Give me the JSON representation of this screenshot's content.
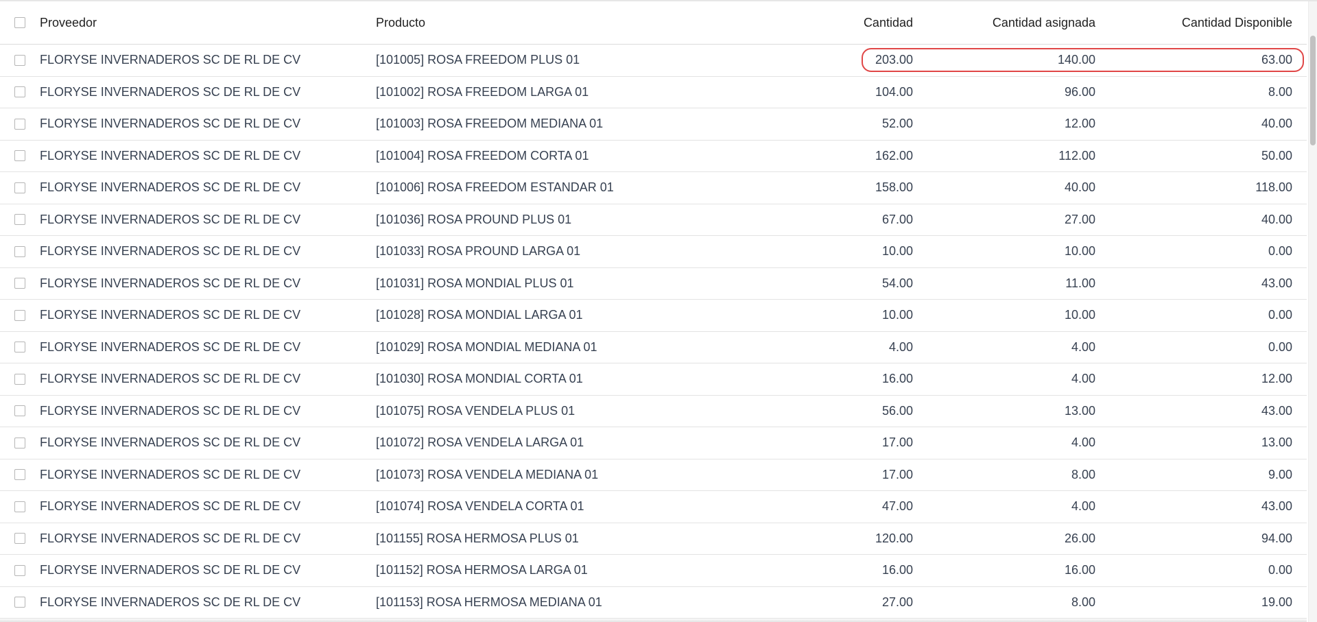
{
  "table": {
    "columns": {
      "proveedor": "Proveedor",
      "producto": "Producto",
      "cantidad": "Cantidad",
      "cantidad_asignada": "Cantidad asignada",
      "cantidad_disponible": "Cantidad Disponible"
    },
    "rows": [
      {
        "proveedor": "FLORYSE INVERNADEROS SC DE RL DE CV",
        "producto": "[101005] ROSA FREEDOM PLUS 01",
        "cantidad": "203.00",
        "asignada": "140.00",
        "disponible": "63.00"
      },
      {
        "proveedor": "FLORYSE INVERNADEROS SC DE RL DE CV",
        "producto": "[101002] ROSA FREEDOM LARGA 01",
        "cantidad": "104.00",
        "asignada": "96.00",
        "disponible": "8.00"
      },
      {
        "proveedor": "FLORYSE INVERNADEROS SC DE RL DE CV",
        "producto": "[101003] ROSA FREEDOM MEDIANA 01",
        "cantidad": "52.00",
        "asignada": "12.00",
        "disponible": "40.00"
      },
      {
        "proveedor": "FLORYSE INVERNADEROS SC DE RL DE CV",
        "producto": "[101004] ROSA FREEDOM CORTA 01",
        "cantidad": "162.00",
        "asignada": "112.00",
        "disponible": "50.00"
      },
      {
        "proveedor": "FLORYSE INVERNADEROS SC DE RL DE CV",
        "producto": "[101006] ROSA FREEDOM ESTANDAR 01",
        "cantidad": "158.00",
        "asignada": "40.00",
        "disponible": "118.00"
      },
      {
        "proveedor": "FLORYSE INVERNADEROS SC DE RL DE CV",
        "producto": "[101036] ROSA PROUND PLUS 01",
        "cantidad": "67.00",
        "asignada": "27.00",
        "disponible": "40.00"
      },
      {
        "proveedor": "FLORYSE INVERNADEROS SC DE RL DE CV",
        "producto": "[101033] ROSA PROUND LARGA 01",
        "cantidad": "10.00",
        "asignada": "10.00",
        "disponible": "0.00"
      },
      {
        "proveedor": "FLORYSE INVERNADEROS SC DE RL DE CV",
        "producto": "[101031] ROSA MONDIAL PLUS 01",
        "cantidad": "54.00",
        "asignada": "11.00",
        "disponible": "43.00"
      },
      {
        "proveedor": "FLORYSE INVERNADEROS SC DE RL DE CV",
        "producto": "[101028] ROSA MONDIAL LARGA 01",
        "cantidad": "10.00",
        "asignada": "10.00",
        "disponible": "0.00"
      },
      {
        "proveedor": "FLORYSE INVERNADEROS SC DE RL DE CV",
        "producto": "[101029] ROSA MONDIAL MEDIANA 01",
        "cantidad": "4.00",
        "asignada": "4.00",
        "disponible": "0.00"
      },
      {
        "proveedor": "FLORYSE INVERNADEROS SC DE RL DE CV",
        "producto": "[101030] ROSA MONDIAL CORTA 01",
        "cantidad": "16.00",
        "asignada": "4.00",
        "disponible": "12.00"
      },
      {
        "proveedor": "FLORYSE INVERNADEROS SC DE RL DE CV",
        "producto": "[101075] ROSA VENDELA PLUS 01",
        "cantidad": "56.00",
        "asignada": "13.00",
        "disponible": "43.00"
      },
      {
        "proveedor": "FLORYSE INVERNADEROS SC DE RL DE CV",
        "producto": "[101072] ROSA VENDELA LARGA 01",
        "cantidad": "17.00",
        "asignada": "4.00",
        "disponible": "13.00"
      },
      {
        "proveedor": "FLORYSE INVERNADEROS SC DE RL DE CV",
        "producto": "[101073] ROSA VENDELA MEDIANA 01",
        "cantidad": "17.00",
        "asignada": "8.00",
        "disponible": "9.00"
      },
      {
        "proveedor": "FLORYSE INVERNADEROS SC DE RL DE CV",
        "producto": "[101074] ROSA VENDELA CORTA 01",
        "cantidad": "47.00",
        "asignada": "4.00",
        "disponible": "43.00"
      },
      {
        "proveedor": "FLORYSE INVERNADEROS SC DE RL DE CV",
        "producto": "[101155] ROSA HERMOSA PLUS 01",
        "cantidad": "120.00",
        "asignada": "26.00",
        "disponible": "94.00"
      },
      {
        "proveedor": "FLORYSE INVERNADEROS SC DE RL DE CV",
        "producto": "[101152] ROSA HERMOSA LARGA 01",
        "cantidad": "16.00",
        "asignada": "16.00",
        "disponible": "0.00"
      },
      {
        "proveedor": "FLORYSE INVERNADEROS SC DE RL DE CV",
        "producto": "[101153] ROSA HERMOSA MEDIANA 01",
        "cantidad": "27.00",
        "asignada": "8.00",
        "disponible": "19.00"
      }
    ]
  },
  "colors": {
    "highlight": "#e04646",
    "row_border": "#e3e3e3",
    "text": "#374151"
  }
}
